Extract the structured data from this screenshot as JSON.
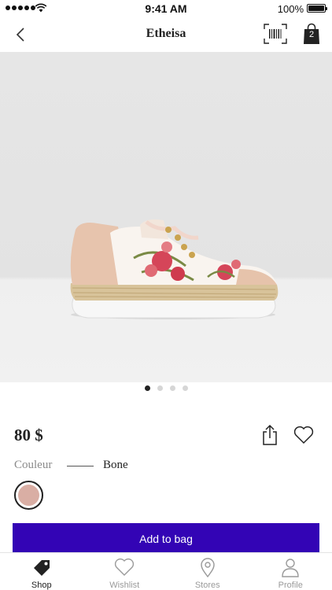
{
  "status_bar": {
    "time": "9:41 AM",
    "battery_percent": "100%",
    "signal_bars": 5,
    "wifi_icon": "wifi-icon"
  },
  "nav": {
    "back_icon": "chevron-left-icon",
    "title": "Etheisa",
    "barcode_icon": "barcode-scan-icon",
    "bag_icon": "shopping-bag-icon",
    "bag_count": "2"
  },
  "product": {
    "image_pages": 4,
    "active_page": 1,
    "price": "80 $",
    "share_icon": "share-icon",
    "wishlist_icon": "heart-icon",
    "color_label": "Couleur",
    "color_value": "Bone",
    "swatch_color": "#d9aea4",
    "add_to_bag_label": "Add to bag"
  },
  "tab_bar": {
    "tabs": [
      {
        "label": "Shop",
        "icon": "tag-icon",
        "active": true
      },
      {
        "label": "Wishlist",
        "icon": "heart-icon",
        "active": false
      },
      {
        "label": "Stores",
        "icon": "map-pin-icon",
        "active": false
      },
      {
        "label": "Profile",
        "icon": "person-icon",
        "active": false
      }
    ]
  },
  "colors": {
    "accent": "#3304b5",
    "text": "#222222",
    "muted": "#8a8a8a"
  }
}
